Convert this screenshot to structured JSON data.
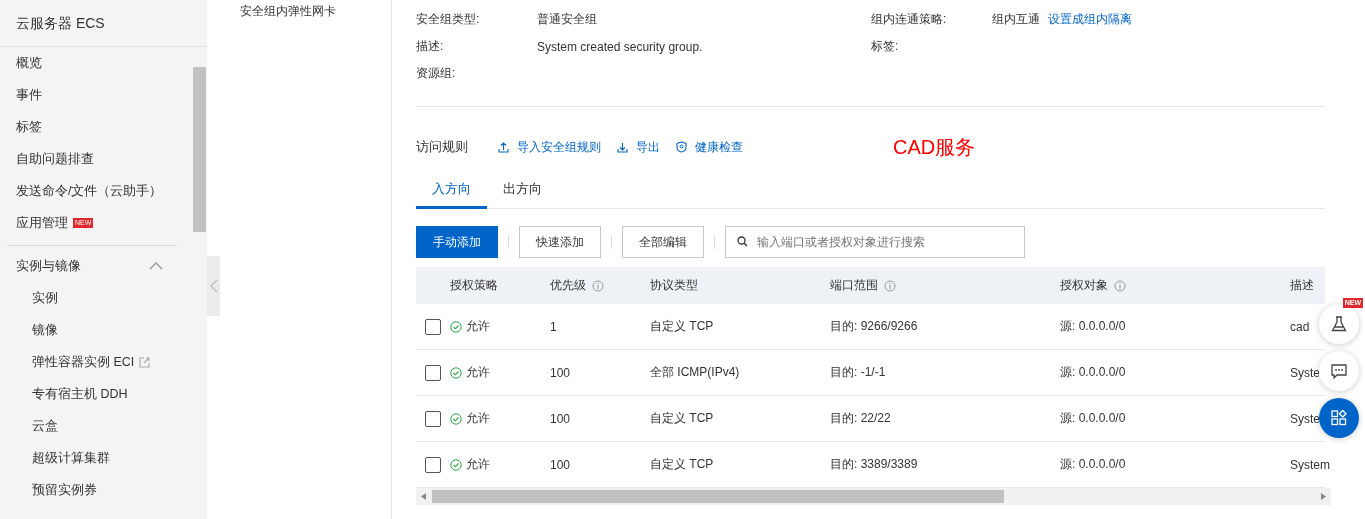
{
  "sidebar": {
    "title": "云服务器 ECS",
    "items": [
      {
        "label": "概览"
      },
      {
        "label": "事件"
      },
      {
        "label": "标签"
      },
      {
        "label": "自助问题排查"
      },
      {
        "label": "发送命令/文件（云助手）"
      },
      {
        "label": "应用管理",
        "badge": "NEW"
      }
    ],
    "group": {
      "label": "实例与镜像",
      "expanded": true,
      "children": [
        {
          "label": "实例",
          "external": false
        },
        {
          "label": "镜像",
          "external": false
        },
        {
          "label": "弹性容器实例 ECI",
          "external": true
        },
        {
          "label": "专有宿主机 DDH",
          "external": false
        },
        {
          "label": "云盒",
          "external": false
        },
        {
          "label": "超级计算集群",
          "external": false
        },
        {
          "label": "预留实例券",
          "external": false
        }
      ]
    }
  },
  "subnav": {
    "items": [
      "安全组内弹性网卡"
    ]
  },
  "details": {
    "left": [
      {
        "label": "安全组类型:",
        "value": "普通安全组"
      },
      {
        "label": "描述:",
        "value": "System created security group."
      },
      {
        "label": "资源组:"
      }
    ],
    "right": [
      {
        "label": "组内连通策略:",
        "value": "组内互通",
        "link": "设置成组内隔离"
      },
      {
        "label": "标签:"
      }
    ]
  },
  "rules": {
    "title": "访问规则",
    "actions": [
      {
        "kind": "import",
        "label": "导入安全组规则"
      },
      {
        "kind": "export",
        "label": "导出"
      },
      {
        "kind": "health",
        "label": "健康检查"
      }
    ],
    "annotation": "CAD服务",
    "tabs": [
      {
        "label": "入方向",
        "selected": true
      },
      {
        "label": "出方向",
        "selected": false
      }
    ],
    "buttons": [
      {
        "label": "手动添加",
        "primary": true
      },
      {
        "label": "快速添加",
        "primary": false
      },
      {
        "label": "全部编辑",
        "primary": false
      }
    ],
    "search": {
      "placeholder": "输入端口或者授权对象进行搜索"
    },
    "columns": [
      {
        "label": "授权策略",
        "info": false
      },
      {
        "label": "优先级",
        "info": true
      },
      {
        "label": "协议类型",
        "info": false
      },
      {
        "label": "端口范围",
        "info": true
      },
      {
        "label": "授权对象",
        "info": true
      },
      {
        "label": "描述",
        "info": false
      }
    ],
    "rows": [
      {
        "checked": false,
        "policy": "允许",
        "priority": "1",
        "protocol": "自定义 TCP",
        "port": "目的: 9266/9266",
        "source": "源: 0.0.0.0/0",
        "description": "cad"
      },
      {
        "checked": false,
        "policy": "允许",
        "priority": "100",
        "protocol": "全部 ICMP(IPv4)",
        "port": "目的: -1/-1",
        "source": "源: 0.0.0.0/0",
        "description": "Syste"
      },
      {
        "checked": false,
        "policy": "允许",
        "priority": "100",
        "protocol": "自定义 TCP",
        "port": "目的: 22/22",
        "source": "源: 0.0.0.0/0",
        "description": "Syste"
      },
      {
        "checked": false,
        "policy": "允许",
        "priority": "100",
        "protocol": "自定义 TCP",
        "port": "目的: 3389/3389",
        "source": "源: 0.0.0.0/0",
        "description": "System"
      }
    ]
  },
  "floating": {
    "badge": "NEW"
  }
}
